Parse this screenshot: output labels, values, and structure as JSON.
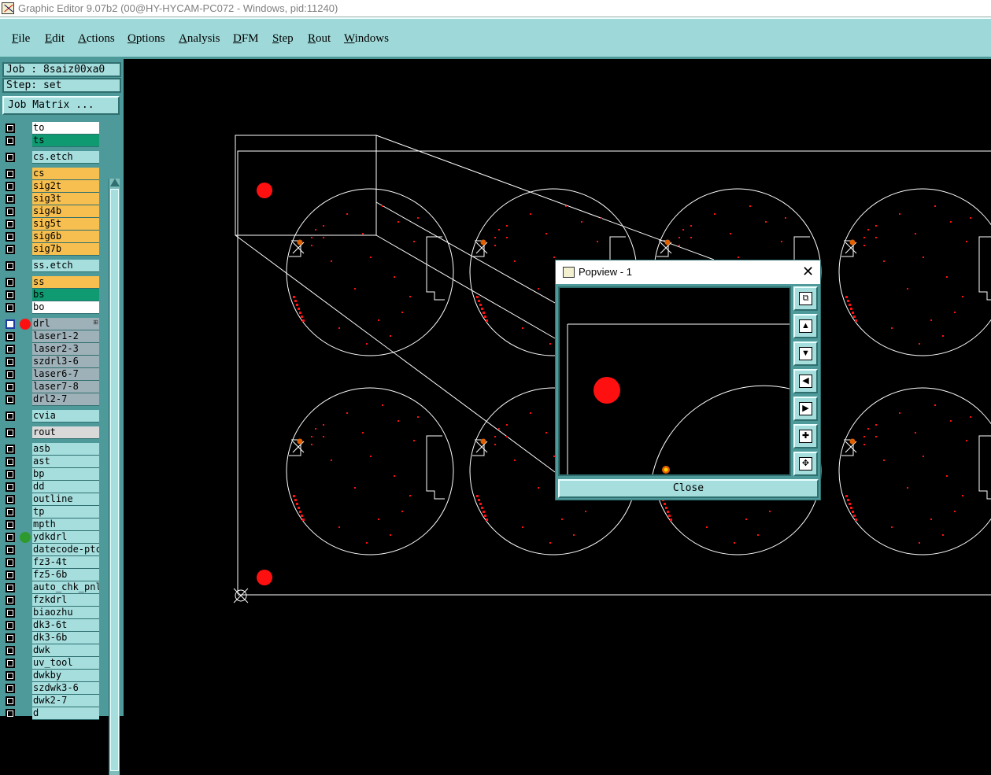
{
  "window": {
    "title": "Graphic Editor 9.07b2 (00@HY-HYCAM-PC072 - Windows, pid:11240)"
  },
  "menu": [
    "File",
    "Edit",
    "Actions",
    "Options",
    "Analysis",
    "DFM",
    "Step",
    "Rout",
    "Windows"
  ],
  "job": {
    "job_label": "Job : 8saiz00xa0",
    "step_label": "Step: set",
    "matrix_button": "Job Matrix ..."
  },
  "layers": [
    {
      "name": "to",
      "color": "#ffffff"
    },
    {
      "name": "ts",
      "color": "#0f9a72"
    },
    {
      "name": "cs.etch",
      "color": "#a6dede"
    },
    {
      "name": "cs",
      "color": "#f7bf4f"
    },
    {
      "name": "sig2t",
      "color": "#f7bf4f"
    },
    {
      "name": "sig3t",
      "color": "#f7bf4f"
    },
    {
      "name": "sig4b",
      "color": "#f7bf4f"
    },
    {
      "name": "sig5t",
      "color": "#f7bf4f"
    },
    {
      "name": "sig6b",
      "color": "#f7bf4f"
    },
    {
      "name": "sig7b",
      "color": "#f7bf4f"
    },
    {
      "name": "ss.etch",
      "color": "#a6dede"
    },
    {
      "name": "ss",
      "color": "#f7bf4f"
    },
    {
      "name": "bs",
      "color": "#0f9a72"
    },
    {
      "name": "bo",
      "color": "#ffffff"
    },
    {
      "name": "drl",
      "color": "#9fb1b8",
      "selected": true,
      "dot": "#ff1010"
    },
    {
      "name": "laser1-2",
      "color": "#9fb1b8"
    },
    {
      "name": "laser2-3",
      "color": "#9fb1b8"
    },
    {
      "name": "szdrl3-6",
      "color": "#9fb1b8"
    },
    {
      "name": "laser6-7",
      "color": "#9fb1b8"
    },
    {
      "name": "laser7-8",
      "color": "#9fb1b8"
    },
    {
      "name": "drl2-7",
      "color": "#9fb1b8"
    },
    {
      "name": "cvia",
      "color": "#a6dede"
    },
    {
      "name": "rout",
      "color": "#d9d9d9"
    },
    {
      "name": "asb",
      "color": "#a6dede"
    },
    {
      "name": "ast",
      "color": "#a6dede"
    },
    {
      "name": "bp",
      "color": "#a6dede"
    },
    {
      "name": "dd",
      "color": "#a6dede"
    },
    {
      "name": "outline",
      "color": "#a6dede"
    },
    {
      "name": "tp",
      "color": "#a6dede"
    },
    {
      "name": "mpth",
      "color": "#a6dede"
    },
    {
      "name": "ydkdrl",
      "color": "#a6dede",
      "dot": "#2e9a2e"
    },
    {
      "name": "datecode-ptc",
      "color": "#a6dede"
    },
    {
      "name": "fz3-4t",
      "color": "#a6dede"
    },
    {
      "name": "fz5-6b",
      "color": "#a6dede"
    },
    {
      "name": "auto_chk_pnl",
      "color": "#a6dede"
    },
    {
      "name": "fzkdrl",
      "color": "#a6dede"
    },
    {
      "name": "biaozhu",
      "color": "#a6dede"
    },
    {
      "name": "dk3-6t",
      "color": "#a6dede"
    },
    {
      "name": "dk3-6b",
      "color": "#a6dede"
    },
    {
      "name": "dwk",
      "color": "#a6dede"
    },
    {
      "name": "uv_tool",
      "color": "#a6dede"
    },
    {
      "name": "dwkby",
      "color": "#a6dede"
    },
    {
      "name": "szdwk3-6",
      "color": "#a6dede"
    },
    {
      "name": "dwk2-7",
      "color": "#a6dede"
    },
    {
      "name": "d",
      "color": "#a6dede"
    }
  ],
  "popview": {
    "title": "Popview - 1",
    "close_label": "Close",
    "buttons": [
      "zoom-fit-icon",
      "pan-up-icon",
      "pan-down-icon",
      "pan-left-icon",
      "pan-right-icon",
      "zoom-in-icon",
      "zoom-out-icon"
    ]
  },
  "colors": {
    "ui_bg": "#9ed8d8",
    "panel_dark": "#4e9a9a",
    "canvas_bg": "#000000",
    "feature_red": "#ff1010",
    "outline_white": "#ffffff"
  }
}
